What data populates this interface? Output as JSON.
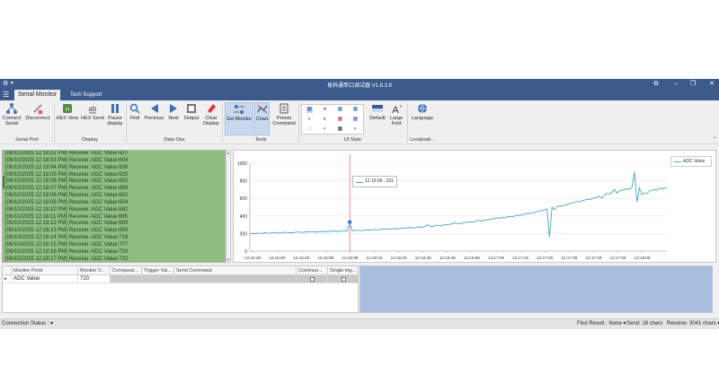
{
  "window": {
    "title": "易科通串口调试器  V1.6.3.8",
    "controls": [
      "⧉",
      "–",
      "❐",
      "✕"
    ]
  },
  "tabs": [
    {
      "label": "Serial Monitor",
      "active": true
    },
    {
      "label": "Tech Support",
      "active": false
    }
  ],
  "ribbon": {
    "buttons": {
      "connect": "Connect Serial",
      "disconnect": "Disconnect",
      "hex_view": "HEX View",
      "hex_send": "HEX Send",
      "pause": "Pause display",
      "find": "Find",
      "previous": "Previous",
      "next": "Next",
      "output": "Output",
      "clear": "Clear Display",
      "set_monitor": "Set Monitor",
      "chart": "Chart",
      "preset": "Preset Command",
      "default": "Default",
      "large_font": "Large Font",
      "language": "Language"
    },
    "groups": {
      "serial_port": "Serial Port",
      "display": "Display",
      "data_ops": "Data Ops",
      "tools": "Tools",
      "ui_style": "UI Style",
      "localization": "Localizati..."
    }
  },
  "log": {
    "lines": [
      "[06/10/2025 12:18:02 PM] Receive: ADC Value:427",
      "[06/10/2025 12:18:03 PM] Receive: ADC Value:604",
      "[06/10/2025 12:18:04 PM] Receive: ADC Value:636",
      "[06/10/2025 12:18:05 PM] Receive: ADC Value:925",
      "[06/10/2025 12:18:06 PM] Receive: ADC Value:653",
      "[06/10/2025 12:18:07 PM] Receive: ADC Value:656",
      "[06/10/2025 12:18:08 PM] Receive: ADC Value:662",
      "[06/10/2025 12:18:09 PM] Receive: ADC Value:654",
      "[06/10/2025 12:18:10 PM] Receive: ADC Value:682",
      "[06/10/2025 12:18:11 PM] Receive: ADC Value:695",
      "[06/10/2025 12:18:12 PM] Receive: ADC Value:699",
      "[06/10/2025 12:18:13 PM] Receive: ADC Value:695",
      "[06/10/2025 12:18:14 PM] Receive: ADC Value:718",
      "[06/10/2025 12:18:15 PM] Receive: ADC Value:707",
      "[06/10/2025 12:18:16 PM] Receive: ADC Value:720",
      "[06/10/2025 12:18:17 PM] Receive: ADC Value:720"
    ]
  },
  "chart_data": {
    "type": "line",
    "series": [
      {
        "name": "ADC Value",
        "values": [
          195,
          200,
          198,
          205,
          202,
          200,
          210,
          205,
          203,
          207,
          212,
          208,
          205,
          210,
          215,
          212,
          210,
          208,
          213,
          218,
          215,
          212,
          216,
          220,
          218,
          222,
          219,
          216,
          221,
          225,
          222,
          220,
          224,
          228,
          230,
          226,
          224,
          229,
          232,
          228,
          331,
          230,
          234,
          238,
          236,
          232,
          240,
          244,
          240,
          238,
          245,
          242,
          246,
          250,
          248,
          252,
          250,
          254,
          256,
          252,
          258,
          262,
          260,
          264,
          268,
          265,
          262,
          270,
          275,
          272,
          278,
          300,
          285,
          280,
          290,
          295,
          288,
          292,
          300,
          298,
          305,
          310,
          320,
          315,
          312,
          318,
          325,
          330,
          335,
          328,
          338,
          345,
          350,
          340,
          355,
          350,
          360,
          365,
          370,
          380,
          372,
          385,
          378,
          390,
          395,
          388,
          400,
          410,
          405,
          415,
          420,
          430,
          425,
          435,
          440,
          448,
          456,
          462,
          470,
          478,
          160,
          500,
          470,
          505,
          515,
          510,
          525,
          530,
          540,
          548,
          556,
          565,
          560,
          572,
          580,
          590,
          585,
          595,
          605,
          612,
          625,
          600,
          640,
          655,
          650,
          668,
          700,
          660,
          685,
          695,
          700,
          710,
          705,
          720,
          900,
          560,
          720,
          640,
          662,
          654,
          682,
          695,
          699,
          695,
          718,
          707,
          720,
          720
        ]
      }
    ],
    "x_ticks": [
      "12:15:29",
      "12:15:39",
      "12:15:49",
      "12:15:59",
      "12:16:09",
      "12:16:19",
      "12:16:29",
      "12:16:39",
      "12:16:49",
      "12:16:59",
      "12:17:09",
      "12:17:19",
      "12:17:29",
      "12:17:39",
      "12:17:49",
      "12:17:59",
      "12:18:09"
    ],
    "y_ticks": [
      "0",
      "200",
      "400",
      "600",
      "800",
      "1000"
    ],
    "ylim": [
      0,
      1000
    ],
    "legend": "top-right",
    "tooltip": {
      "text": "12:16:09 : 331",
      "index": 40
    }
  },
  "grid": {
    "headers": [
      "Monitor Point",
      "Monitor V...",
      "Comparat...",
      "Trigger Val...",
      "Send Command",
      "Continuo...",
      "Single trig..."
    ],
    "row": {
      "arrow": "▸",
      "point": "ADC Value",
      "value": "720"
    }
  },
  "status": {
    "connection": "Connection Status : ▾",
    "find": "Find Result : None ▾",
    "send": "Send: 18 chars",
    "receive": "Receive: 3041 chars ▾"
  }
}
